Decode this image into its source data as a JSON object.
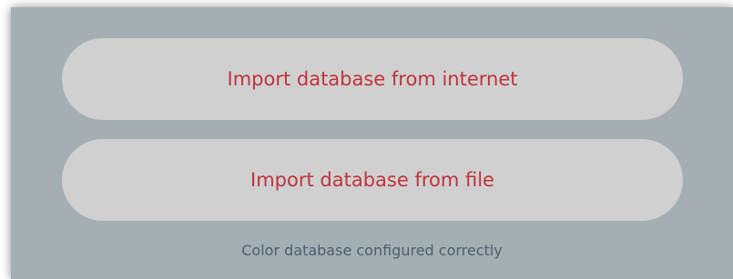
{
  "buttons": {
    "import_internet_label": "Import database from internet",
    "import_file_label": "Import database from file"
  },
  "status": {
    "message": "Color database configured correctly"
  },
  "colors": {
    "panel_background": "#a3afb2",
    "button_background": "#d0d0d0",
    "button_text": "#c0333a",
    "status_text": "#4b5e70"
  }
}
